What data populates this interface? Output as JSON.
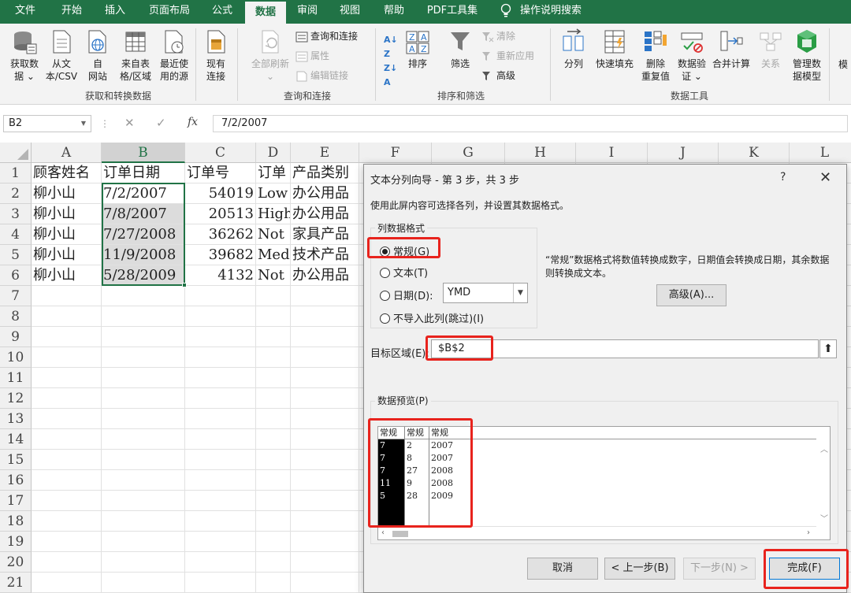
{
  "ribbon_tabs": [
    "文件",
    "开始",
    "插入",
    "页面布局",
    "公式",
    "数据",
    "审阅",
    "视图",
    "帮助",
    "PDF工具集"
  ],
  "active_tab": "数据",
  "tell_me": "操作说明搜索",
  "ribbon": {
    "get_data": {
      "label": "获取和转换数据",
      "buttons": [
        {
          "l1": "获取数",
          "l2": "据 ⌄",
          "icon": "database-icon"
        },
        {
          "l1": "从文",
          "l2": "本/CSV",
          "icon": "text-file-icon"
        },
        {
          "l1": "自",
          "l2": "网站",
          "icon": "web-icon"
        },
        {
          "l1": "来自表",
          "l2": "格/区域",
          "icon": "table-icon"
        },
        {
          "l1": "最近使",
          "l2": "用的源",
          "icon": "recent-source-icon"
        },
        {
          "l1": "现有",
          "l2": "连接",
          "icon": "existing-connection-icon"
        }
      ]
    },
    "queries": {
      "label": "查询和连接",
      "refresh_all": {
        "l1": "全部刷新",
        "l2": "⌄"
      },
      "items": [
        "查询和连接",
        "属性",
        "编辑链接"
      ]
    },
    "sort_filter": {
      "label": "排序和筛选",
      "sort": "排序",
      "filter": "筛选",
      "items": [
        "清除",
        "重新应用",
        "高级"
      ]
    },
    "data_tools": {
      "label": "数据工具",
      "buttons": [
        {
          "l1": "分列",
          "l2": ""
        },
        {
          "l1": "快速填充",
          "l2": ""
        },
        {
          "l1": "删除",
          "l2": "重复值"
        },
        {
          "l1": "数据验",
          "l2": "证 ⌄"
        },
        {
          "l1": "合并计算",
          "l2": ""
        },
        {
          "l1": "关系",
          "l2": ""
        },
        {
          "l1": "管理数",
          "l2": "据模型"
        }
      ]
    },
    "overflow_label": "模"
  },
  "formula_bar": {
    "name_box": "B2",
    "cancel": "✕",
    "confirm": "✓",
    "fx": "fx",
    "value": "7/2/2007"
  },
  "columns": [
    "A",
    "B",
    "C",
    "D",
    "E",
    "F",
    "G",
    "H",
    "I",
    "J",
    "K",
    "L"
  ],
  "rows": [
    "1",
    "2",
    "3",
    "4",
    "5",
    "6",
    "7",
    "8",
    "9",
    "10",
    "11",
    "12",
    "13",
    "14",
    "15",
    "16",
    "17",
    "18",
    "19",
    "20",
    "21"
  ],
  "sheet": {
    "header": [
      "顾客姓名",
      "订单日期",
      "订单号",
      "订单",
      "产品类别"
    ],
    "data": [
      [
        "柳小山",
        "7/2/2007",
        "54019",
        "Low",
        "办公用品"
      ],
      [
        "柳小山",
        "7/8/2007",
        "20513",
        "High",
        "办公用品"
      ],
      [
        "柳小山",
        "7/27/2008",
        "36262",
        "Not",
        "家具产品"
      ],
      [
        "柳小山",
        "11/9/2008",
        "39682",
        "Medi",
        "技术产品"
      ],
      [
        "柳小山",
        "5/28/2009",
        "4132",
        "Not",
        "办公用品"
      ]
    ]
  },
  "dialog": {
    "title": "文本分列向导 - 第 3 步，共 3 步",
    "help": "?",
    "close": "✕",
    "description": "使用此屏内容可选择各列，并设置其数据格式。",
    "column_format_legend": "列数据格式",
    "radios": [
      "常规(G)",
      "文本(T)",
      "日期(D):",
      "不导入此列(跳过)(I)"
    ],
    "selected_radio": 0,
    "date_format": "YMD",
    "note": "“常规”数据格式将数值转换成数字，日期值会转换成日期，其余数据则转换成文本。",
    "advanced_button": "高级(A)...",
    "target_label": "目标区域(E):",
    "target_value": "$B$2",
    "preview_legend": "数据预览(P)",
    "preview": {
      "headers": [
        "常规",
        "常规",
        "常规"
      ],
      "col1": [
        "7",
        "7",
        "7",
        "11",
        "5"
      ],
      "col2": [
        "2",
        "8",
        "27",
        "9",
        "28"
      ],
      "col3": [
        "2007",
        "2007",
        "2008",
        "2008",
        "2009"
      ]
    },
    "buttons": {
      "cancel": "取消",
      "back": "< 上一步(B)",
      "next": "下一步(N) >",
      "finish": "完成(F)"
    }
  },
  "colors": {
    "excel_green": "#217346",
    "highlight_red": "#e8231d"
  }
}
